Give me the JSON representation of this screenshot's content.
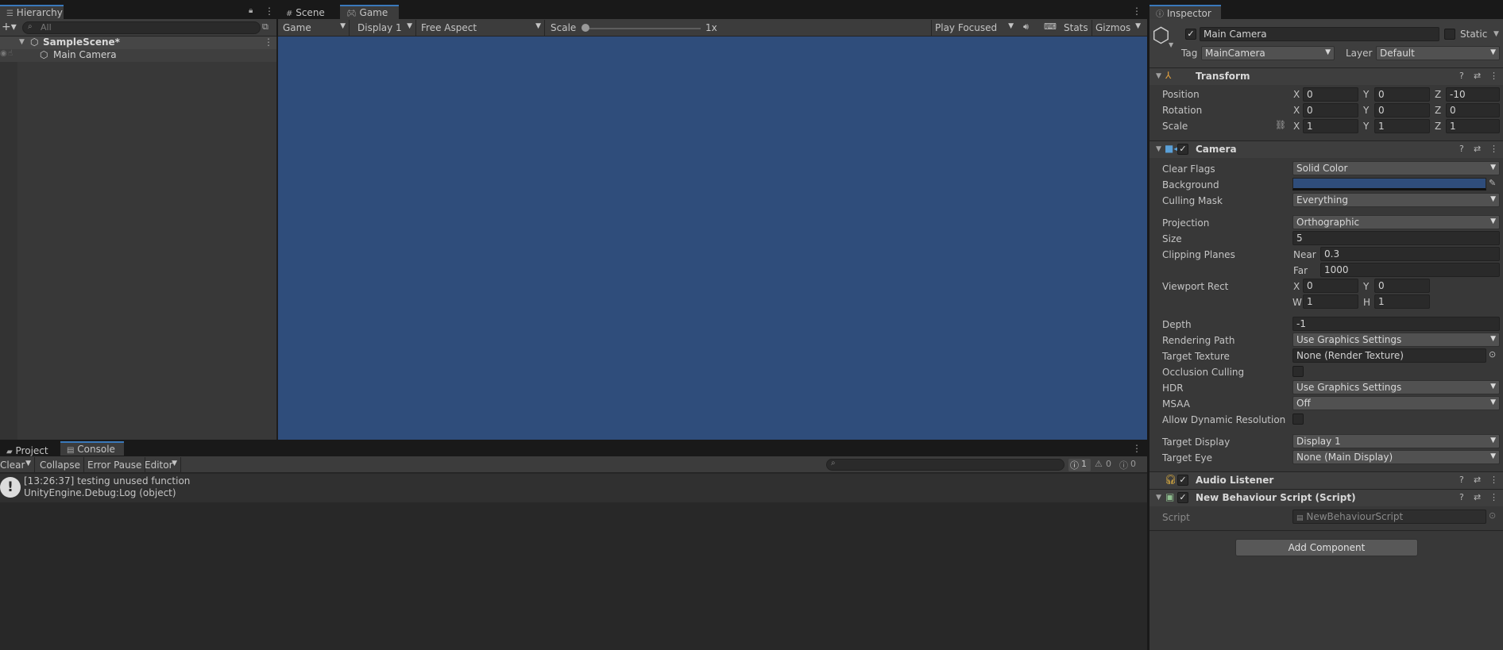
{
  "hierarchy": {
    "tab_label": "Hierarchy",
    "search_placeholder": "All",
    "scene_name": "SampleScene*",
    "items": [
      "Main Camera"
    ]
  },
  "center": {
    "tabs": [
      "Scene",
      "Game"
    ],
    "toolbar": {
      "game": "Game",
      "display": "Display 1",
      "aspect": "Free Aspect",
      "scale_label": "Scale",
      "scale_value": "1x",
      "play_mode": "Play Focused",
      "stats": "Stats",
      "gizmos": "Gizmos"
    },
    "viewport_color": "#2f4d7b"
  },
  "console": {
    "tabs": [
      "Project",
      "Console"
    ],
    "toolbar": {
      "clear": "Clear",
      "collapse": "Collapse",
      "error_pause": "Error Pause",
      "editor": "Editor"
    },
    "counts": {
      "info": "1",
      "warnings": "0",
      "errors": "0"
    },
    "entries": [
      {
        "line1": "[13:26:37] testing unused function",
        "line2": "UnityEngine.Debug:Log (object)"
      }
    ]
  },
  "inspector": {
    "tab_label": "Inspector",
    "object_name": "Main Camera",
    "static_label": "Static",
    "tag_label": "Tag",
    "tag_value": "MainCamera",
    "layer_label": "Layer",
    "layer_value": "Default",
    "transform": {
      "title": "Transform",
      "position_label": "Position",
      "rotation_label": "Rotation",
      "scale_label": "Scale",
      "position": {
        "x": "0",
        "y": "0",
        "z": "-10"
      },
      "rotation": {
        "x": "0",
        "y": "0",
        "z": "0"
      },
      "scale": {
        "x": "1",
        "y": "1",
        "z": "1"
      }
    },
    "camera": {
      "title": "Camera",
      "clear_flags_label": "Clear Flags",
      "clear_flags": "Solid Color",
      "background_label": "Background",
      "background_color": "#2f4d7b",
      "culling_mask_label": "Culling Mask",
      "culling_mask": "Everything",
      "projection_label": "Projection",
      "projection": "Orthographic",
      "size_label": "Size",
      "size": "5",
      "clipping_label": "Clipping Planes",
      "near_label": "Near",
      "near": "0.3",
      "far_label": "Far",
      "far": "1000",
      "viewport_label": "Viewport Rect",
      "viewport": {
        "x": "0",
        "y": "0",
        "w": "1",
        "h": "1"
      },
      "depth_label": "Depth",
      "depth": "-1",
      "rendering_path_label": "Rendering Path",
      "rendering_path": "Use Graphics Settings",
      "target_texture_label": "Target Texture",
      "target_texture": "None (Render Texture)",
      "occlusion_label": "Occlusion Culling",
      "hdr_label": "HDR",
      "hdr": "Use Graphics Settings",
      "msaa_label": "MSAA",
      "msaa": "Off",
      "dynres_label": "Allow Dynamic Resolution",
      "target_display_label": "Target Display",
      "target_display": "Display 1",
      "target_eye_label": "Target Eye",
      "target_eye": "None (Main Display)"
    },
    "audio_listener": {
      "title": "Audio Listener"
    },
    "script_component": {
      "title": "New Behaviour Script (Script)",
      "script_label": "Script",
      "script_value": "NewBehaviourScript"
    },
    "add_component": "Add Component"
  }
}
